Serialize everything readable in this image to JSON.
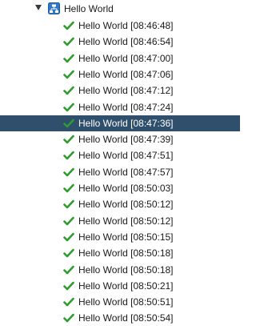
{
  "tree": {
    "root": {
      "label": "Hello World",
      "expanded": true,
      "icon": "network-node-icon"
    },
    "items": [
      {
        "label": "Hello World [08:46:48]",
        "status": "check-icon",
        "selected": false
      },
      {
        "label": "Hello World [08:46:54]",
        "status": "check-icon",
        "selected": false
      },
      {
        "label": "Hello World [08:47:00]",
        "status": "check-icon",
        "selected": false
      },
      {
        "label": "Hello World [08:47:06]",
        "status": "check-icon",
        "selected": false
      },
      {
        "label": "Hello World [08:47:12]",
        "status": "check-icon",
        "selected": false
      },
      {
        "label": "Hello World [08:47:24]",
        "status": "check-icon",
        "selected": false
      },
      {
        "label": "Hello World [08:47:36]",
        "status": "check-icon",
        "selected": true
      },
      {
        "label": "Hello World [08:47:39]",
        "status": "check-icon",
        "selected": false
      },
      {
        "label": "Hello World [08:47:51]",
        "status": "check-icon",
        "selected": false
      },
      {
        "label": "Hello World [08:47:57]",
        "status": "check-icon",
        "selected": false
      },
      {
        "label": "Hello World [08:50:03]",
        "status": "check-icon",
        "selected": false
      },
      {
        "label": "Hello World [08:50:12]",
        "status": "check-icon",
        "selected": false
      },
      {
        "label": "Hello World [08:50:12]",
        "status": "check-icon",
        "selected": false
      },
      {
        "label": "Hello World [08:50:15]",
        "status": "check-icon",
        "selected": false
      },
      {
        "label": "Hello World [08:50:18]",
        "status": "check-icon",
        "selected": false
      },
      {
        "label": "Hello World [08:50:18]",
        "status": "check-icon",
        "selected": false
      },
      {
        "label": "Hello World [08:50:21]",
        "status": "check-icon",
        "selected": false
      },
      {
        "label": "Hello World [08:50:51]",
        "status": "check-icon",
        "selected": false
      },
      {
        "label": "Hello World [08:50:54]",
        "status": "check-icon",
        "selected": false
      }
    ],
    "colors": {
      "selection": "#2f4f6c",
      "check": "#2e9c2e",
      "node_icon": "#2f78c8"
    }
  }
}
